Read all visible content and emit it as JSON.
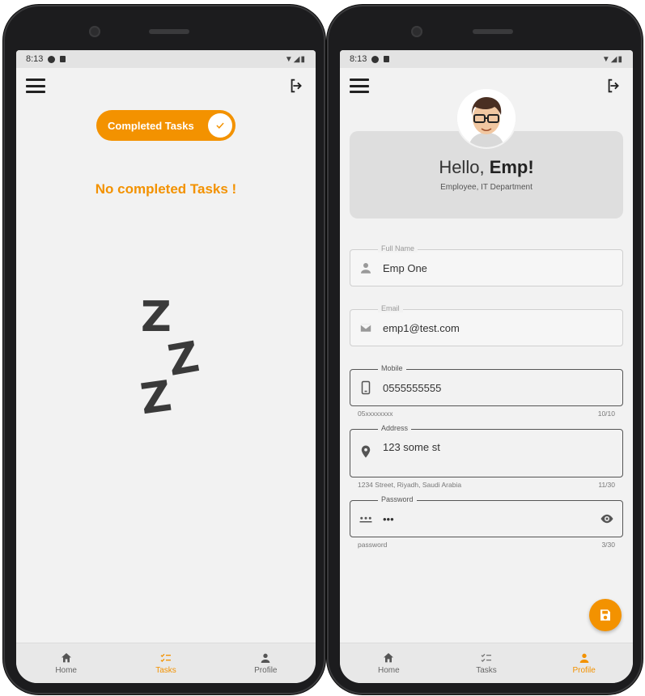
{
  "colors": {
    "accent": "#f39200",
    "text": "#333333",
    "screen_bg": "#f2f2f2"
  },
  "left": {
    "status": {
      "time": "8:13",
      "signal": "▼◢▮"
    },
    "toggle": {
      "label": "Completed Tasks",
      "checked": true
    },
    "empty_message": "No completed Tasks !",
    "sleep_letters": [
      "Z",
      "Z",
      "Z"
    ],
    "nav": [
      {
        "label": "Home",
        "icon": "home-icon",
        "active": false
      },
      {
        "label": "Tasks",
        "icon": "tasks-icon",
        "active": true
      },
      {
        "label": "Profile",
        "icon": "person-icon",
        "active": false
      }
    ]
  },
  "right": {
    "status": {
      "time": "8:13",
      "signal": "▼◢▮"
    },
    "greeting": {
      "prefix": "Hello,",
      "name": "Emp!"
    },
    "subtitle": "Employee, IT Department",
    "fields": {
      "full_name": {
        "label": "Full Name",
        "value": "Emp One",
        "icon": "person-icon"
      },
      "email": {
        "label": "Email",
        "value": "emp1@test.com",
        "icon": "mail-icon"
      },
      "mobile": {
        "label": "Mobile",
        "value": "0555555555",
        "icon": "phone-icon",
        "helper": "05xxxxxxxx",
        "counter": "10/10"
      },
      "address": {
        "label": "Address",
        "value": "123 some st",
        "icon": "location-icon",
        "helper": "1234 Street, Riyadh, Saudi Arabia",
        "counter": "11/30"
      },
      "password": {
        "label": "Password",
        "value": "•••",
        "icon": "password-icon",
        "helper": "password",
        "counter": "3/30"
      }
    },
    "nav": [
      {
        "label": "Home",
        "icon": "home-icon",
        "active": false
      },
      {
        "label": "Tasks",
        "icon": "tasks-icon",
        "active": false
      },
      {
        "label": "Profile",
        "icon": "person-icon",
        "active": true
      }
    ]
  }
}
